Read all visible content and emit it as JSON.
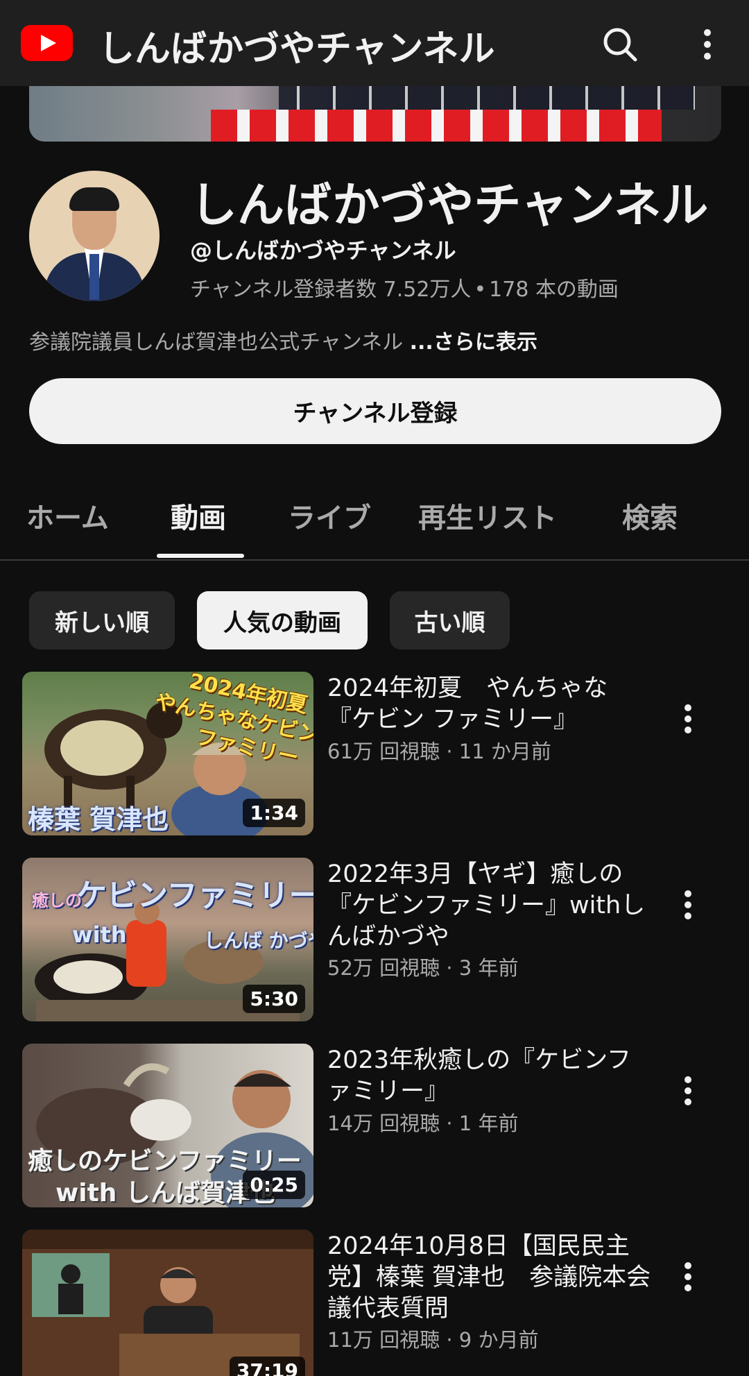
{
  "appbar": {
    "title": "しんばかづやチャンネル",
    "logo_icon": "youtube-logo-icon",
    "search_icon": "search-icon",
    "more_icon": "more-vert-icon"
  },
  "channel": {
    "name": "しんばかづやチャンネル",
    "handle": "@しんばかづやチャンネル",
    "subscribers": "チャンネル登録者数 7.52万人",
    "separator": "•",
    "video_count": "178 本の動画",
    "description": "参議院議員しんば賀津也公式チャンネル ",
    "more_label": "...さらに表示",
    "subscribe_label": "チャンネル登録"
  },
  "tabs": [
    {
      "label": "ホーム"
    },
    {
      "label": "動画"
    },
    {
      "label": "ライブ"
    },
    {
      "label": "再生リスト"
    },
    {
      "label": "検索"
    }
  ],
  "chips": [
    {
      "label": "新しい順"
    },
    {
      "label": "人気の動画"
    },
    {
      "label": "古い順"
    }
  ],
  "videos": [
    {
      "title": "2024年初夏　やんちゃな『ケビン ファミリー』",
      "meta": "61万 回視聴 · 11 か月前",
      "duration": "1:34",
      "thumb_text_1": "2024年初夏",
      "thumb_text_2": "やんちゃなケビン",
      "thumb_text_3": "ファミリー",
      "thumb_text_4": "榛葉 賀津也"
    },
    {
      "title": "2022年3月【ヤギ】癒しの『ケビンファミリー』withしんばかづや",
      "meta": "52万 回視聴 · 3 年前",
      "duration": "5:30",
      "thumb_text_1": "癒しの",
      "thumb_text_2": "ケビンファミリー",
      "thumb_text_3": "with",
      "thumb_text_4": "しんば かづや"
    },
    {
      "title": "2023年秋癒しの『ケビンファミリー』",
      "meta": "14万 回視聴 · 1 年前",
      "duration": "0:25",
      "thumb_text_1": "癒しのケビンファミリー",
      "thumb_text_2": "with しんば賀津也"
    },
    {
      "title": "2024年10月8日【国民民主党】榛葉 賀津也　参議院本会議代表質問",
      "meta": "11万 回視聴 · 9 か月前",
      "duration": "37:19"
    }
  ]
}
